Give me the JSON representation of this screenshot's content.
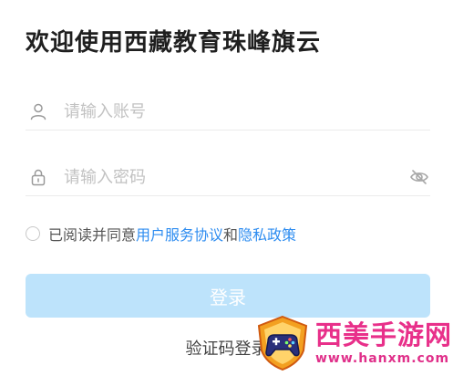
{
  "header": {
    "title": "欢迎使用西藏教育珠峰旗云"
  },
  "form": {
    "account": {
      "placeholder": "请输入账号",
      "value": "",
      "icon": "user-icon"
    },
    "password": {
      "placeholder": "请输入密码",
      "value": "",
      "icon": "lock-icon",
      "toggle_icon": "eye-off-icon"
    }
  },
  "agreement": {
    "checked": false,
    "prefix": "已阅读并同意",
    "terms_link": "用户服务协议",
    "conjunction": "和",
    "privacy_link": "隐私政策"
  },
  "actions": {
    "login_label": "登录",
    "code_login_label": "验证码登录"
  },
  "watermark": {
    "name": "西美手游网",
    "url": "www.hanxm.com"
  },
  "colors": {
    "link": "#2d8cf0",
    "login_button_bg": "#bde3fb",
    "watermark": "#e8308a"
  }
}
